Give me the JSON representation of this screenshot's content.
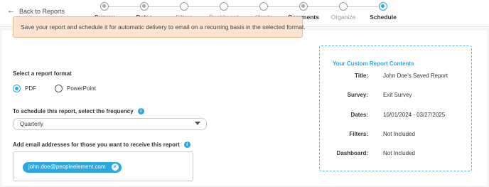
{
  "nav": {
    "back_label": "Back to Reports"
  },
  "steps": [
    {
      "label": "Survey",
      "state": "done"
    },
    {
      "label": "Dates",
      "state": "done"
    },
    {
      "label": "Filters",
      "state": "todo"
    },
    {
      "label": "Dashboard",
      "state": "todo"
    },
    {
      "label": "Charts",
      "state": "todo"
    },
    {
      "label": "Comments",
      "state": "done"
    },
    {
      "label": "Organize",
      "state": "todo"
    },
    {
      "label": "Schedule",
      "state": "active"
    }
  ],
  "notice": "Save your report and schedule it for automatic delivery to email on a recurring basis in the selected format.",
  "format": {
    "label": "Select a report format",
    "options": [
      "PDF",
      "PowerPoint"
    ],
    "selected": "PDF"
  },
  "frequency": {
    "label": "To schedule this report, select the frequency",
    "value": "Quarterly"
  },
  "recipients": {
    "label": "Add email addresses for those you want to receive this report",
    "emails": [
      "john.doe@peopleelement.com"
    ]
  },
  "summary": {
    "title": "Your Custom Report Contents",
    "rows": [
      {
        "key": "Title:",
        "value": "John Doe's Saved Report"
      },
      {
        "key": "Survey:",
        "value": "Exit Survey"
      },
      {
        "key": "Dates:",
        "value": "10/01/2024 - 03/27/2025"
      },
      {
        "key": "Filters:",
        "value": "Not Included"
      },
      {
        "key": "Dashboard:",
        "value": "Not Included"
      }
    ]
  },
  "colors": {
    "accent": "#2aa8df",
    "notice_bg": "#fbe3cf",
    "notice_border": "#f0b887"
  }
}
